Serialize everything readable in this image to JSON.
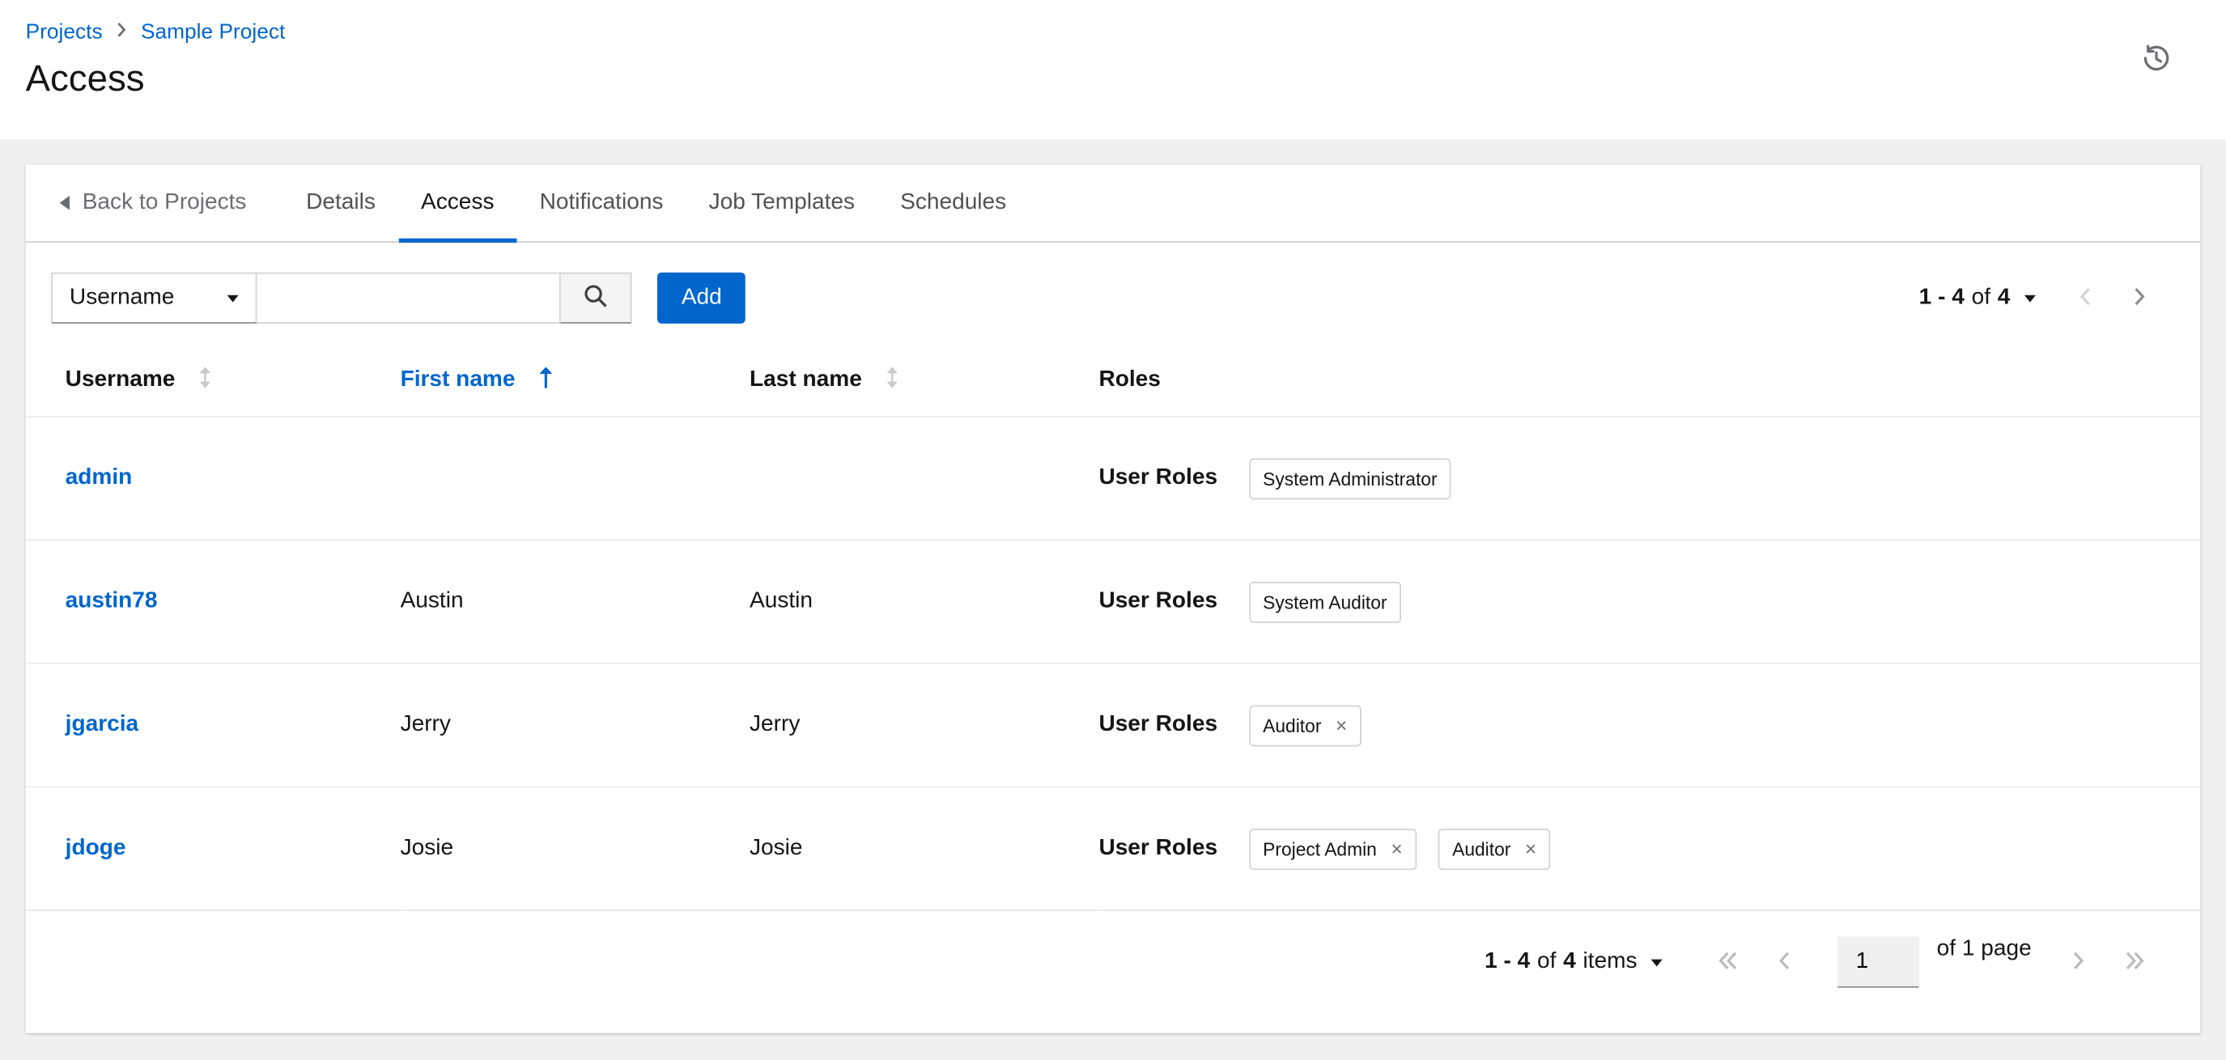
{
  "page": {
    "breadcrumb": {
      "items": [
        "Projects",
        "Sample Project"
      ]
    },
    "title": "Access"
  },
  "tabs": {
    "back_label": "Back to Projects",
    "items": [
      {
        "label": "Details"
      },
      {
        "label": "Access"
      },
      {
        "label": "Notifications"
      },
      {
        "label": "Job Templates"
      },
      {
        "label": "Schedules"
      }
    ],
    "active": "Access"
  },
  "toolbar": {
    "filter": {
      "selected": "Username"
    },
    "search": {
      "value": "",
      "placeholder": ""
    },
    "add_label": "Add",
    "pagination": {
      "range": "1 - 4",
      "of": "of",
      "total": "4"
    }
  },
  "table": {
    "headers": [
      {
        "label": "Username",
        "sortable": true,
        "sorted": null
      },
      {
        "label": "First name",
        "sortable": true,
        "sorted": "asc"
      },
      {
        "label": "Last name",
        "sortable": true,
        "sorted": null
      },
      {
        "label": "Roles",
        "sortable": false,
        "sorted": null
      }
    ],
    "roles_label": "User Roles",
    "rows": [
      {
        "username": "admin",
        "first_name": "",
        "last_name": "",
        "chips": [
          {
            "label": "System Administrator",
            "removable": false
          }
        ]
      },
      {
        "username": "austin78",
        "first_name": "Austin",
        "last_name": "Austin",
        "chips": [
          {
            "label": "System Auditor",
            "removable": false
          }
        ]
      },
      {
        "username": "jgarcia",
        "first_name": "Jerry",
        "last_name": "Jerry",
        "chips": [
          {
            "label": "Auditor",
            "removable": true
          }
        ]
      },
      {
        "username": "jdoge",
        "first_name": "Josie",
        "last_name": "Josie",
        "chips": [
          {
            "label": "Project Admin",
            "removable": true
          },
          {
            "label": "Auditor",
            "removable": true
          }
        ]
      }
    ]
  },
  "footer": {
    "pagination": {
      "range": "1 - 4",
      "of": "of",
      "total": "4",
      "suffix": "items"
    },
    "page_input": "1",
    "page_label": "of 1 page"
  },
  "colors": {
    "primary": "#0066cc",
    "link": "#0066cc",
    "background": "#f0f0f0"
  }
}
